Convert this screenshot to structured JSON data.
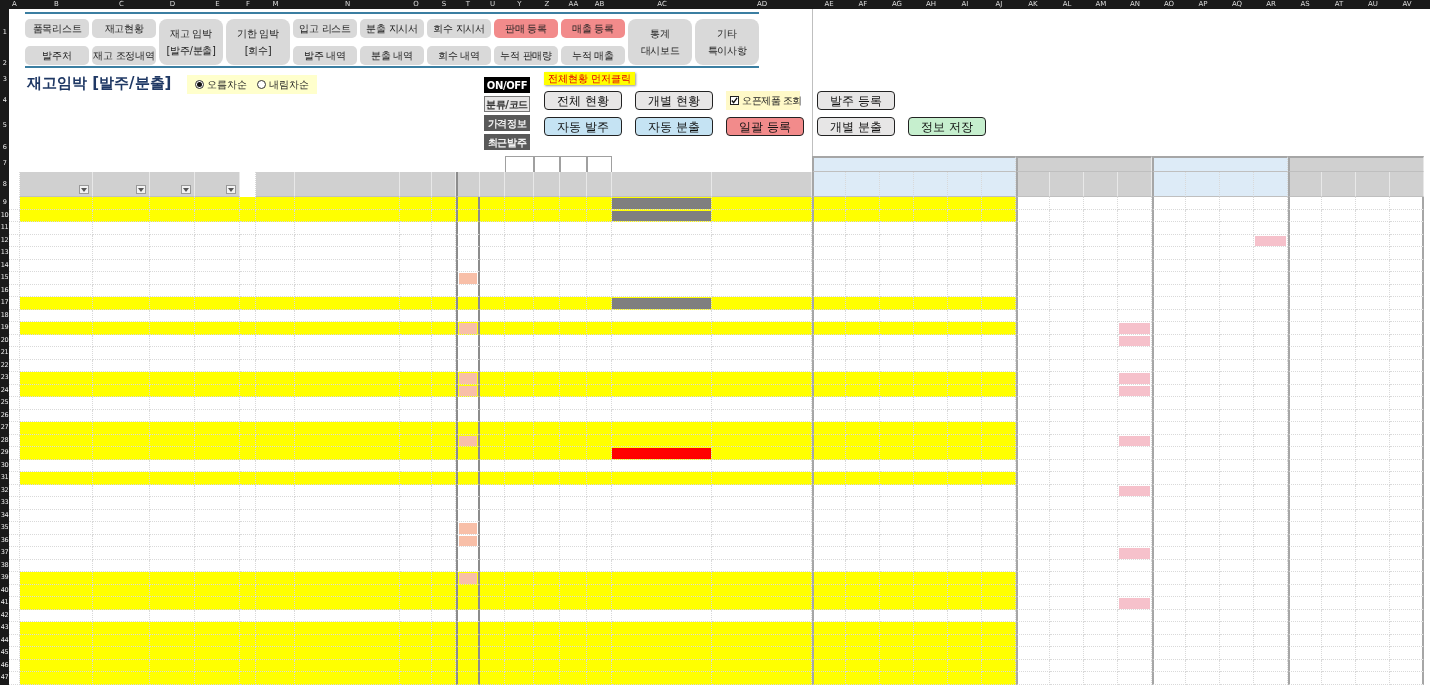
{
  "columns": [
    "A",
    "B",
    "C",
    "D",
    "E",
    "F",
    "M",
    "N",
    "O",
    "S",
    "T",
    "U",
    "Y",
    "Z",
    "AA",
    "AB",
    "AC",
    "AD",
    "AE",
    "AF",
    "AG",
    "AH",
    "AI",
    "AJ",
    "AK",
    "AL",
    "AM",
    "AN",
    "AO",
    "AP",
    "AQ",
    "AR",
    "AS",
    "AT",
    "AU",
    "AV"
  ],
  "top_rows": [
    "1",
    "2",
    "3",
    "4",
    "5",
    "6",
    "7",
    "8"
  ],
  "nav": [
    {
      "kind": "stack",
      "buttons": [
        {
          "label": "품목리스트",
          "accent": false
        },
        {
          "label": "발주처",
          "accent": false
        }
      ]
    },
    {
      "kind": "stack",
      "buttons": [
        {
          "label": "재고현황",
          "accent": false
        },
        {
          "label": "재고 조정내역",
          "accent": false
        }
      ]
    },
    {
      "kind": "tall",
      "lines": [
        "재고 임박",
        "[발주/분출]"
      ],
      "accent": false
    },
    {
      "kind": "tall",
      "lines": [
        "기한 임박",
        "[회수]"
      ],
      "accent": false
    },
    {
      "kind": "stack",
      "buttons": [
        {
          "label": "입고 리스트",
          "accent": false
        },
        {
          "label": "발주 내역",
          "accent": false
        }
      ]
    },
    {
      "kind": "stack",
      "buttons": [
        {
          "label": "분출 지시서",
          "accent": false
        },
        {
          "label": "분출 내역",
          "accent": false
        }
      ]
    },
    {
      "kind": "stack",
      "buttons": [
        {
          "label": "회수 지시서",
          "accent": false
        },
        {
          "label": "회수 내역",
          "accent": false
        }
      ]
    },
    {
      "kind": "stack",
      "buttons": [
        {
          "label": "판매 등록",
          "accent": true
        },
        {
          "label": "누적 판매량",
          "accent": false
        }
      ]
    },
    {
      "kind": "stack",
      "buttons": [
        {
          "label": "매출 등록",
          "accent": true
        },
        {
          "label": "누적 매출",
          "accent": false
        }
      ]
    },
    {
      "kind": "tall",
      "lines": [
        "통계",
        "대시보드"
      ],
      "accent": false
    },
    {
      "kind": "tall",
      "lines": [
        "기타",
        "특이사항"
      ],
      "accent": false
    }
  ],
  "title": "재고임박 [발주/분출]",
  "sort": [
    {
      "label": "오름차순",
      "selected": true
    },
    {
      "label": "내림차순",
      "selected": false
    }
  ],
  "toggles": [
    {
      "label": "ON/OFF",
      "kind": "master",
      "on": true
    },
    {
      "label": "분류/코드",
      "kind": "option",
      "on": true
    },
    {
      "label": "가격정보",
      "kind": "option",
      "on": false
    },
    {
      "label": "최근발주",
      "kind": "option",
      "on": false
    }
  ],
  "callout": "전체현황 먼저클릭",
  "action_rows": [
    [
      {
        "kind": "button",
        "label": "전체 현황",
        "color": "#e7e6e6"
      },
      {
        "kind": "button",
        "label": "개별 현황",
        "color": "#e7e6e6"
      },
      {
        "kind": "checkbox",
        "label": "오픈제품 조회",
        "checked": true
      },
      {
        "kind": "button",
        "label": "발주 등록",
        "color": "#e7e6e6"
      }
    ],
    [
      {
        "kind": "button",
        "label": "자동 발주",
        "color": "#c5e3f3"
      },
      {
        "kind": "button",
        "label": "자동 분출",
        "color": "#c5e3f3"
      },
      {
        "kind": "button",
        "label": "일괄 등록",
        "color": "#f28b8b"
      },
      {
        "kind": "button",
        "label": "개별 분출",
        "color": "#e7e6e6"
      },
      {
        "kind": "button",
        "label": "정보 저장",
        "color": "#c6efce"
      }
    ]
  ],
  "rows": [
    {
      "number": "9",
      "highlighted": true,
      "status": {
        "color": "#7f7f7f"
      },
      "t_flag": false,
      "an_flag": false,
      "ar_flag": false
    },
    {
      "number": "10",
      "highlighted": true,
      "status": {
        "color": "#7f7f7f"
      },
      "t_flag": false,
      "an_flag": false,
      "ar_flag": false
    },
    {
      "number": "11",
      "highlighted": false,
      "t_flag": false,
      "an_flag": false,
      "ar_flag": false
    },
    {
      "number": "12",
      "highlighted": false,
      "t_flag": false,
      "an_flag": false,
      "ar_flag": true
    },
    {
      "number": "13",
      "highlighted": false,
      "t_flag": false,
      "an_flag": false,
      "ar_flag": false
    },
    {
      "number": "14",
      "highlighted": false,
      "t_flag": false,
      "an_flag": false,
      "ar_flag": false
    },
    {
      "number": "15",
      "highlighted": false,
      "t_flag": true,
      "an_flag": false,
      "ar_flag": false
    },
    {
      "number": "16",
      "highlighted": false,
      "t_flag": false,
      "an_flag": false,
      "ar_flag": false
    },
    {
      "number": "17",
      "highlighted": true,
      "status": {
        "color": "#7f7f7f"
      },
      "t_flag": false,
      "an_flag": false,
      "ar_flag": false
    },
    {
      "number": "18",
      "highlighted": false,
      "t_flag": false,
      "an_flag": false,
      "ar_flag": false
    },
    {
      "number": "19",
      "highlighted": true,
      "t_flag": true,
      "an_flag": true,
      "ar_flag": false
    },
    {
      "number": "20",
      "highlighted": false,
      "t_flag": false,
      "an_flag": true,
      "ar_flag": false
    },
    {
      "number": "21",
      "highlighted": false,
      "t_flag": false,
      "an_flag": false,
      "ar_flag": false
    },
    {
      "number": "22",
      "highlighted": false,
      "t_flag": false,
      "an_flag": false,
      "ar_flag": false
    },
    {
      "number": "23",
      "highlighted": true,
      "t_flag": true,
      "an_flag": true,
      "ar_flag": false
    },
    {
      "number": "24",
      "highlighted": true,
      "t_flag": true,
      "an_flag": true,
      "ar_flag": false
    },
    {
      "number": "25",
      "highlighted": false,
      "t_flag": false,
      "an_flag": false,
      "ar_flag": false
    },
    {
      "number": "26",
      "highlighted": false,
      "t_flag": false,
      "an_flag": false,
      "ar_flag": false
    },
    {
      "number": "27",
      "highlighted": true,
      "t_flag": false,
      "an_flag": false,
      "ar_flag": false
    },
    {
      "number": "28",
      "highlighted": true,
      "t_flag": true,
      "an_flag": true,
      "ar_flag": false
    },
    {
      "number": "29",
      "highlighted": true,
      "status": {
        "color": "#ff0000"
      },
      "t_flag": false,
      "an_flag": false,
      "ar_flag": false
    },
    {
      "number": "30",
      "highlighted": false,
      "t_flag": false,
      "an_flag": false,
      "ar_flag": false
    },
    {
      "number": "31",
      "highlighted": true,
      "t_flag": false,
      "an_flag": false,
      "ar_flag": false
    },
    {
      "number": "32",
      "highlighted": false,
      "t_flag": false,
      "an_flag": true,
      "ar_flag": false
    },
    {
      "number": "33",
      "highlighted": false,
      "t_flag": false,
      "an_flag": false,
      "ar_flag": false
    },
    {
      "number": "34",
      "highlighted": false,
      "t_flag": false,
      "an_flag": false,
      "ar_flag": false
    },
    {
      "number": "35",
      "highlighted": false,
      "t_flag": true,
      "an_flag": false,
      "ar_flag": false
    },
    {
      "number": "36",
      "highlighted": false,
      "t_flag": true,
      "an_flag": false,
      "ar_flag": false
    },
    {
      "number": "37",
      "highlighted": false,
      "t_flag": false,
      "an_flag": true,
      "ar_flag": false
    },
    {
      "number": "38",
      "highlighted": false,
      "t_flag": false,
      "an_flag": false,
      "ar_flag": false
    },
    {
      "number": "39",
      "highlighted": true,
      "t_flag": true,
      "an_flag": false,
      "ar_flag": false
    },
    {
      "number": "40",
      "highlighted": true,
      "t_flag": false,
      "an_flag": false,
      "ar_flag": false
    },
    {
      "number": "41",
      "highlighted": true,
      "t_flag": false,
      "an_flag": true,
      "ar_flag": false
    },
    {
      "number": "42",
      "highlighted": false,
      "t_flag": false,
      "an_flag": false,
      "ar_flag": false
    },
    {
      "number": "43",
      "highlighted": true,
      "t_flag": false,
      "an_flag": false,
      "ar_flag": false
    },
    {
      "number": "44",
      "highlighted": true,
      "t_flag": false,
      "an_flag": false,
      "ar_flag": false
    },
    {
      "number": "45",
      "highlighted": true,
      "t_flag": false,
      "an_flag": false,
      "ar_flag": false
    },
    {
      "number": "46",
      "highlighted": true,
      "t_flag": false,
      "an_flag": false,
      "ar_flag": false
    },
    {
      "number": "47",
      "highlighted": true,
      "t_flag": false,
      "an_flag": false,
      "ar_flag": false
    }
  ]
}
